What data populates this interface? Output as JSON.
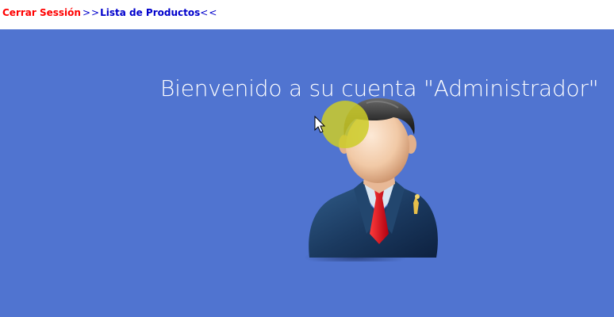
{
  "header": {
    "logout_label": "Cerrar Sessión",
    "products_prefix": ">>",
    "products_label": "Lista de Productos",
    "products_suffix": "<<"
  },
  "main": {
    "welcome_text": "Bienvenido a su cuenta \"Administrador\""
  },
  "colors": {
    "background": "#5074d0",
    "logout_link": "#ff0000",
    "products_link": "#0000cc"
  },
  "icons": {
    "avatar": "administrator-avatar-icon",
    "cursor": "mouse-cursor-icon"
  }
}
